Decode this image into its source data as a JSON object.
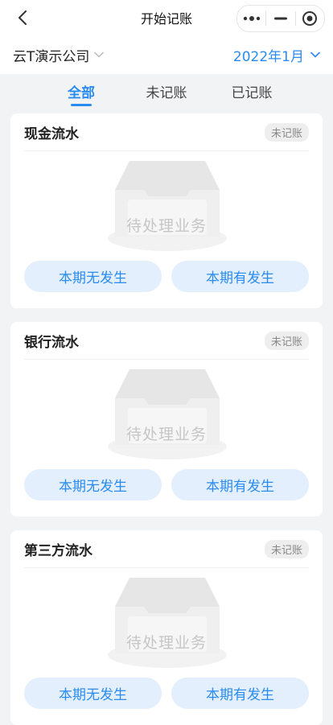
{
  "header": {
    "title": "开始记账"
  },
  "company": {
    "name": "云T演示公司"
  },
  "period": {
    "label": "2022年1月"
  },
  "tabs": [
    {
      "label": "全部",
      "active": true
    },
    {
      "label": "未记账",
      "active": false
    },
    {
      "label": "已记账",
      "active": false
    }
  ],
  "cards": [
    {
      "title": "现金流水",
      "badge": "未记账",
      "empty_text": "待处理业务",
      "btn_none": "本期无发生",
      "btn_some": "本期有发生"
    },
    {
      "title": "银行流水",
      "badge": "未记账",
      "empty_text": "待处理业务",
      "btn_none": "本期无发生",
      "btn_some": "本期有发生"
    },
    {
      "title": "第三方流水",
      "badge": "未记账",
      "empty_text": "待处理业务",
      "btn_none": "本期无发生",
      "btn_some": "本期有发生"
    }
  ],
  "colors": {
    "accent": "#2a8cf0",
    "button_bg": "#e3effc",
    "page_bg": "#f2f3f5"
  }
}
